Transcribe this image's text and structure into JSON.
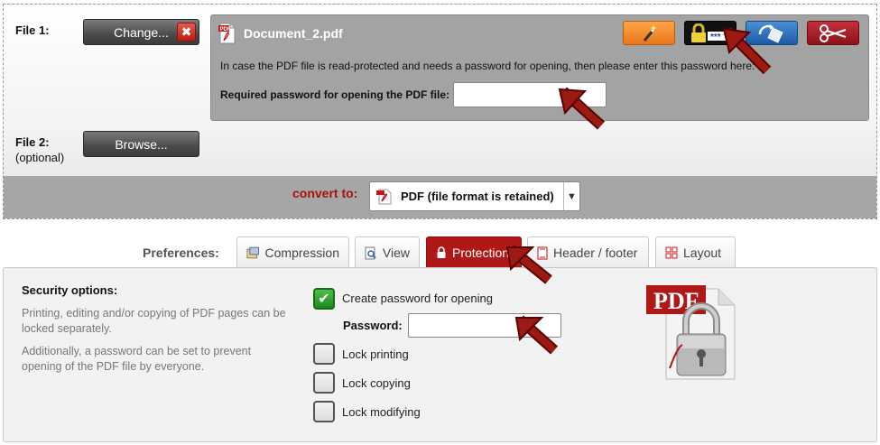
{
  "file1": {
    "label": "File 1:",
    "change_label": "Change...",
    "remove_symbol": "✖",
    "doc_name": "Document_2.pdf",
    "description": "In case the PDF file is read-protected and needs a password for opening, then please enter this password here:",
    "password_label": "Required password for opening the PDF file:",
    "password_value": "",
    "tools": [
      "magic-wand-icon",
      "lock-icon",
      "rotate-icon",
      "scissors-icon"
    ]
  },
  "file2": {
    "label": "File 2:",
    "sublabel": "(optional)",
    "browse_label": "Browse..."
  },
  "convert": {
    "label": "convert to:",
    "selected": "PDF (file format is retained)"
  },
  "preferences": {
    "label": "Preferences:",
    "tabs": [
      {
        "label": "Compression",
        "icon": "compression-icon"
      },
      {
        "label": "View",
        "icon": "view-icon"
      },
      {
        "label": "Protection",
        "icon": "lock-icon",
        "active": true
      },
      {
        "label": "Header / footer",
        "icon": "header-footer-icon"
      },
      {
        "label": "Layout",
        "icon": "layout-icon"
      }
    ]
  },
  "security": {
    "title": "Security options:",
    "text1": "Printing, editing and/or copying of PDF pages can be locked separately.",
    "text2": "Additionally, a password can be set to prevent opening of the PDF file by everyone.",
    "create_password_label": "Create password for opening",
    "create_password_checked": true,
    "password_label": "Password:",
    "password_value": "",
    "lock_printing": "Lock printing",
    "lock_copying": "Lock copying",
    "lock_modifying": "Lock modifying",
    "badge_text": "PDF"
  },
  "colors": {
    "accent_red": "#b01818",
    "panel_gray": "#a3a3a3",
    "check_green": "#2aa02a"
  }
}
